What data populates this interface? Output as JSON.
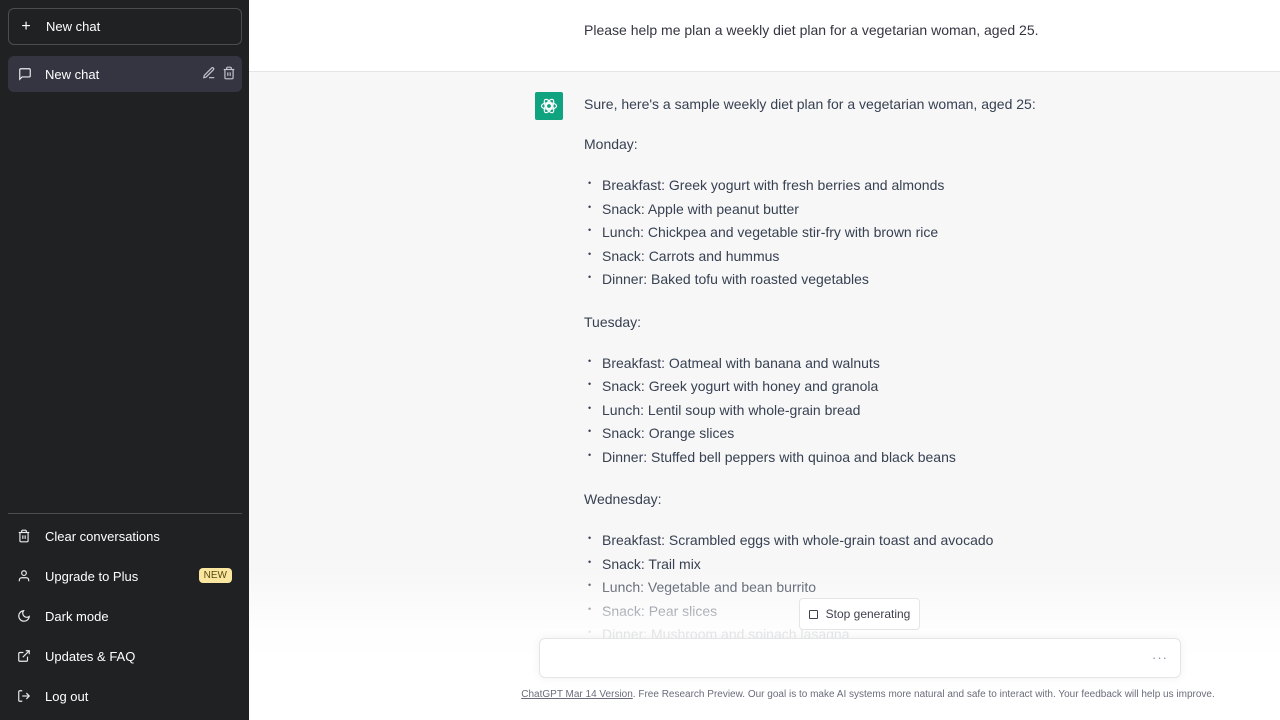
{
  "sidebar": {
    "new_chat_label": "New chat",
    "chats": [
      {
        "label": "New chat"
      }
    ],
    "menu": [
      {
        "label": "Clear conversations",
        "icon": "trash-icon"
      },
      {
        "label": "Upgrade to Plus",
        "icon": "user-icon",
        "badge": "NEW"
      },
      {
        "label": "Dark mode",
        "icon": "moon-icon"
      },
      {
        "label": "Updates & FAQ",
        "icon": "external-link-icon"
      },
      {
        "label": "Log out",
        "icon": "logout-icon"
      }
    ]
  },
  "conversation": {
    "user_message": "Please help me plan a weekly diet plan for a vegetarian woman, aged 25.",
    "assistant": {
      "intro": "Sure, here's a sample weekly diet plan for a vegetarian woman, aged 25:",
      "days": [
        {
          "day": "Monday:",
          "meals": [
            "Breakfast: Greek yogurt with fresh berries and almonds",
            "Snack: Apple with peanut butter",
            "Lunch: Chickpea and vegetable stir-fry with brown rice",
            "Snack: Carrots and hummus",
            "Dinner: Baked tofu with roasted vegetables"
          ]
        },
        {
          "day": "Tuesday:",
          "meals": [
            "Breakfast: Oatmeal with banana and walnuts",
            "Snack: Greek yogurt with honey and granola",
            "Lunch: Lentil soup with whole-grain bread",
            "Snack: Orange slices",
            "Dinner: Stuffed bell peppers with quinoa and black beans"
          ]
        },
        {
          "day": "Wednesday:",
          "meals": [
            "Breakfast: Scrambled eggs with whole-grain toast and avocado",
            "Snack: Trail mix",
            "Lunch: Vegetable and bean burrito",
            "Snack: Pear slices",
            "Dinner: Mushroom and spinach lasagna"
          ]
        }
      ]
    }
  },
  "composer": {
    "stop_label": "Stop generating",
    "status_dots": "···"
  },
  "footer": {
    "link": "ChatGPT Mar 14 Version",
    "text": ". Free Research Preview. Our goal is to make AI systems more natural and safe to interact with. Your feedback will help us improve."
  },
  "colors": {
    "brand": "#10a37f",
    "sidebar_bg": "#202123",
    "badge_bg": "#fae69e"
  }
}
